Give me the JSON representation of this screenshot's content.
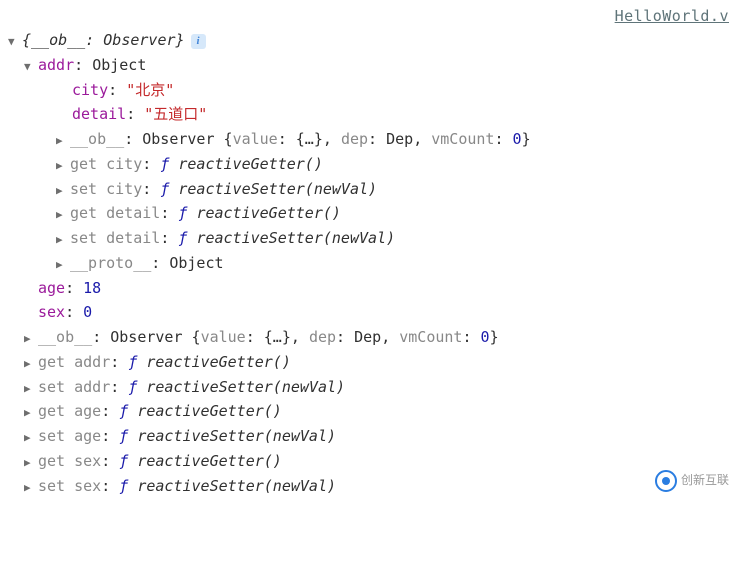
{
  "source_link": "HelloWorld.v",
  "root": {
    "key": "__ob__",
    "type": "Observer"
  },
  "addr": {
    "key": "addr",
    "type": "Object",
    "city_key": "city",
    "city_val": "\"北京\"",
    "detail_key": "detail",
    "detail_val": "\"五道口\"",
    "ob_key": "__ob__",
    "ob_summary_pre": "Observer {",
    "ob_value_k": "value",
    "ob_value_v": "{…}",
    "ob_dep_k": "dep",
    "ob_dep_v": "Dep",
    "ob_vm_k": "vmCount",
    "ob_vm_v": "0",
    "ob_summary_suf": "}",
    "get_city_k": "get city",
    "get_city_fn": "reactiveGetter()",
    "set_city_k": "set city",
    "set_city_fn": "reactiveSetter(newVal)",
    "get_detail_k": "get detail",
    "get_detail_fn": "reactiveGetter()",
    "set_detail_k": "set detail",
    "set_detail_fn": "reactiveSetter(newVal)",
    "proto_k": "__proto__",
    "proto_v": "Object"
  },
  "age": {
    "key": "age",
    "val": "18"
  },
  "sex": {
    "key": "sex",
    "val": "0"
  },
  "ob": {
    "key": "__ob__",
    "summary_pre": "Observer {",
    "value_k": "value",
    "value_v": "{…}",
    "dep_k": "dep",
    "dep_v": "Dep",
    "vm_k": "vmCount",
    "vm_v": "0",
    "summary_suf": "}"
  },
  "accessors": {
    "get_addr_k": "get addr",
    "get_addr_fn": "reactiveGetter()",
    "set_addr_k": "set addr",
    "set_addr_fn": "reactiveSetter(newVal)",
    "get_age_k": "get age",
    "get_age_fn": "reactiveGetter()",
    "set_age_k": "set age",
    "set_age_fn": "reactiveSetter(newVal)",
    "get_sex_k": "get sex",
    "get_sex_fn": "reactiveGetter()",
    "set_sex_k": "set sex",
    "set_sex_fn": "reactiveSetter(newVal)"
  },
  "fn_f": "ƒ",
  "watermark": "创新互联"
}
